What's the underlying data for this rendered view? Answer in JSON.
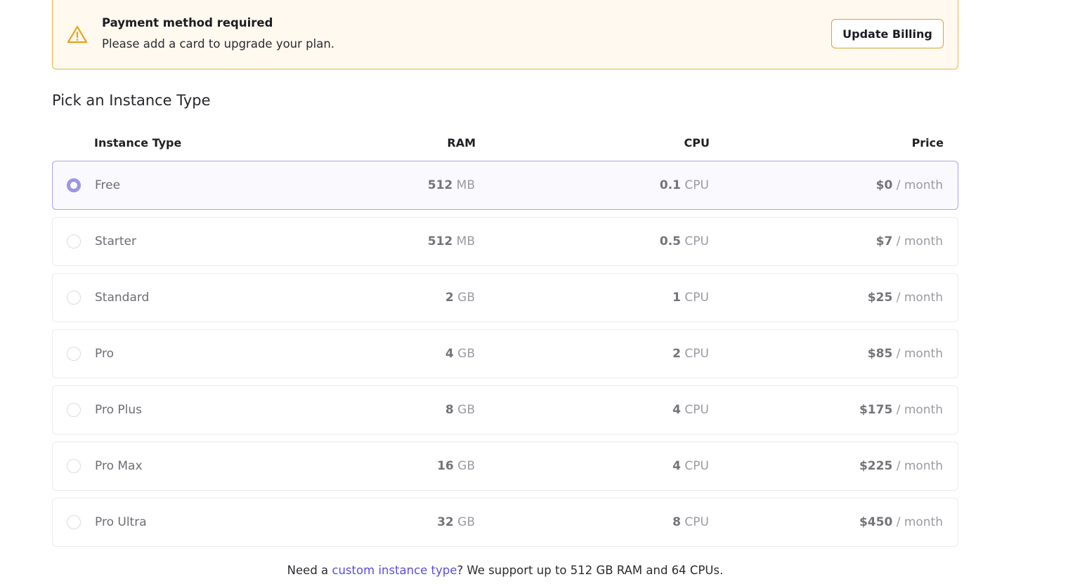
{
  "banner": {
    "title": "Payment method required",
    "message": "Please add a card to upgrade your plan.",
    "button_label": "Update Billing",
    "icon": "warning-triangle-icon",
    "accent_color": "#e8b44a"
  },
  "section_title": "Pick an Instance Type",
  "table": {
    "headers": {
      "instance_type": "Instance Type",
      "ram": "RAM",
      "cpu": "CPU",
      "price": "Price"
    },
    "selected_index": 0,
    "rows": [
      {
        "name": "Free",
        "ram_value": "512",
        "ram_unit": "MB",
        "cpu_value": "0.1",
        "cpu_unit": "CPU",
        "price_value": "$0",
        "price_unit": "/ month"
      },
      {
        "name": "Starter",
        "ram_value": "512",
        "ram_unit": "MB",
        "cpu_value": "0.5",
        "cpu_unit": "CPU",
        "price_value": "$7",
        "price_unit": "/ month"
      },
      {
        "name": "Standard",
        "ram_value": "2",
        "ram_unit": "GB",
        "cpu_value": "1",
        "cpu_unit": "CPU",
        "price_value": "$25",
        "price_unit": "/ month"
      },
      {
        "name": "Pro",
        "ram_value": "4",
        "ram_unit": "GB",
        "cpu_value": "2",
        "cpu_unit": "CPU",
        "price_value": "$85",
        "price_unit": "/ month"
      },
      {
        "name": "Pro Plus",
        "ram_value": "8",
        "ram_unit": "GB",
        "cpu_value": "4",
        "cpu_unit": "CPU",
        "price_value": "$175",
        "price_unit": "/ month"
      },
      {
        "name": "Pro Max",
        "ram_value": "16",
        "ram_unit": "GB",
        "cpu_value": "4",
        "cpu_unit": "CPU",
        "price_value": "$225",
        "price_unit": "/ month"
      },
      {
        "name": "Pro Ultra",
        "ram_value": "32",
        "ram_unit": "GB",
        "cpu_value": "8",
        "cpu_unit": "CPU",
        "price_value": "$450",
        "price_unit": "/ month"
      }
    ]
  },
  "footer": {
    "prefix": "Need a ",
    "link_text": "custom instance type",
    "suffix": "? We support up to 512 GB RAM and 64 CPUs."
  },
  "colors": {
    "selected_radio": "#9c95e6",
    "link": "#5a4fd9"
  }
}
